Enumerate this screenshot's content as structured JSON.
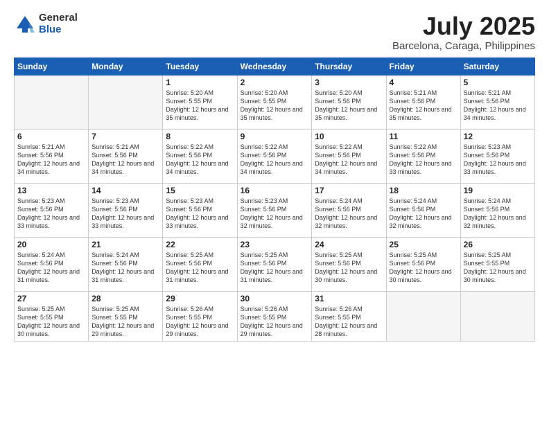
{
  "logo": {
    "general": "General",
    "blue": "Blue"
  },
  "title": "July 2025",
  "subtitle": "Barcelona, Caraga, Philippines",
  "weekdays": [
    "Sunday",
    "Monday",
    "Tuesday",
    "Wednesday",
    "Thursday",
    "Friday",
    "Saturday"
  ],
  "weeks": [
    [
      {
        "day": "",
        "info": ""
      },
      {
        "day": "",
        "info": ""
      },
      {
        "day": "1",
        "info": "Sunrise: 5:20 AM\nSunset: 5:55 PM\nDaylight: 12 hours and 35 minutes."
      },
      {
        "day": "2",
        "info": "Sunrise: 5:20 AM\nSunset: 5:55 PM\nDaylight: 12 hours and 35 minutes."
      },
      {
        "day": "3",
        "info": "Sunrise: 5:20 AM\nSunset: 5:56 PM\nDaylight: 12 hours and 35 minutes."
      },
      {
        "day": "4",
        "info": "Sunrise: 5:21 AM\nSunset: 5:56 PM\nDaylight: 12 hours and 35 minutes."
      },
      {
        "day": "5",
        "info": "Sunrise: 5:21 AM\nSunset: 5:56 PM\nDaylight: 12 hours and 34 minutes."
      }
    ],
    [
      {
        "day": "6",
        "info": "Sunrise: 5:21 AM\nSunset: 5:56 PM\nDaylight: 12 hours and 34 minutes."
      },
      {
        "day": "7",
        "info": "Sunrise: 5:21 AM\nSunset: 5:56 PM\nDaylight: 12 hours and 34 minutes."
      },
      {
        "day": "8",
        "info": "Sunrise: 5:22 AM\nSunset: 5:56 PM\nDaylight: 12 hours and 34 minutes."
      },
      {
        "day": "9",
        "info": "Sunrise: 5:22 AM\nSunset: 5:56 PM\nDaylight: 12 hours and 34 minutes."
      },
      {
        "day": "10",
        "info": "Sunrise: 5:22 AM\nSunset: 5:56 PM\nDaylight: 12 hours and 34 minutes."
      },
      {
        "day": "11",
        "info": "Sunrise: 5:22 AM\nSunset: 5:56 PM\nDaylight: 12 hours and 33 minutes."
      },
      {
        "day": "12",
        "info": "Sunrise: 5:23 AM\nSunset: 5:56 PM\nDaylight: 12 hours and 33 minutes."
      }
    ],
    [
      {
        "day": "13",
        "info": "Sunrise: 5:23 AM\nSunset: 5:56 PM\nDaylight: 12 hours and 33 minutes."
      },
      {
        "day": "14",
        "info": "Sunrise: 5:23 AM\nSunset: 5:56 PM\nDaylight: 12 hours and 33 minutes."
      },
      {
        "day": "15",
        "info": "Sunrise: 5:23 AM\nSunset: 5:56 PM\nDaylight: 12 hours and 33 minutes."
      },
      {
        "day": "16",
        "info": "Sunrise: 5:23 AM\nSunset: 5:56 PM\nDaylight: 12 hours and 32 minutes."
      },
      {
        "day": "17",
        "info": "Sunrise: 5:24 AM\nSunset: 5:56 PM\nDaylight: 12 hours and 32 minutes."
      },
      {
        "day": "18",
        "info": "Sunrise: 5:24 AM\nSunset: 5:56 PM\nDaylight: 12 hours and 32 minutes."
      },
      {
        "day": "19",
        "info": "Sunrise: 5:24 AM\nSunset: 5:56 PM\nDaylight: 12 hours and 32 minutes."
      }
    ],
    [
      {
        "day": "20",
        "info": "Sunrise: 5:24 AM\nSunset: 5:56 PM\nDaylight: 12 hours and 31 minutes."
      },
      {
        "day": "21",
        "info": "Sunrise: 5:24 AM\nSunset: 5:56 PM\nDaylight: 12 hours and 31 minutes."
      },
      {
        "day": "22",
        "info": "Sunrise: 5:25 AM\nSunset: 5:56 PM\nDaylight: 12 hours and 31 minutes."
      },
      {
        "day": "23",
        "info": "Sunrise: 5:25 AM\nSunset: 5:56 PM\nDaylight: 12 hours and 31 minutes."
      },
      {
        "day": "24",
        "info": "Sunrise: 5:25 AM\nSunset: 5:56 PM\nDaylight: 12 hours and 30 minutes."
      },
      {
        "day": "25",
        "info": "Sunrise: 5:25 AM\nSunset: 5:56 PM\nDaylight: 12 hours and 30 minutes."
      },
      {
        "day": "26",
        "info": "Sunrise: 5:25 AM\nSunset: 5:55 PM\nDaylight: 12 hours and 30 minutes."
      }
    ],
    [
      {
        "day": "27",
        "info": "Sunrise: 5:25 AM\nSunset: 5:55 PM\nDaylight: 12 hours and 30 minutes."
      },
      {
        "day": "28",
        "info": "Sunrise: 5:25 AM\nSunset: 5:55 PM\nDaylight: 12 hours and 29 minutes."
      },
      {
        "day": "29",
        "info": "Sunrise: 5:26 AM\nSunset: 5:55 PM\nDaylight: 12 hours and 29 minutes."
      },
      {
        "day": "30",
        "info": "Sunrise: 5:26 AM\nSunset: 5:55 PM\nDaylight: 12 hours and 29 minutes."
      },
      {
        "day": "31",
        "info": "Sunrise: 5:26 AM\nSunset: 5:55 PM\nDaylight: 12 hours and 28 minutes."
      },
      {
        "day": "",
        "info": ""
      },
      {
        "day": "",
        "info": ""
      }
    ]
  ]
}
